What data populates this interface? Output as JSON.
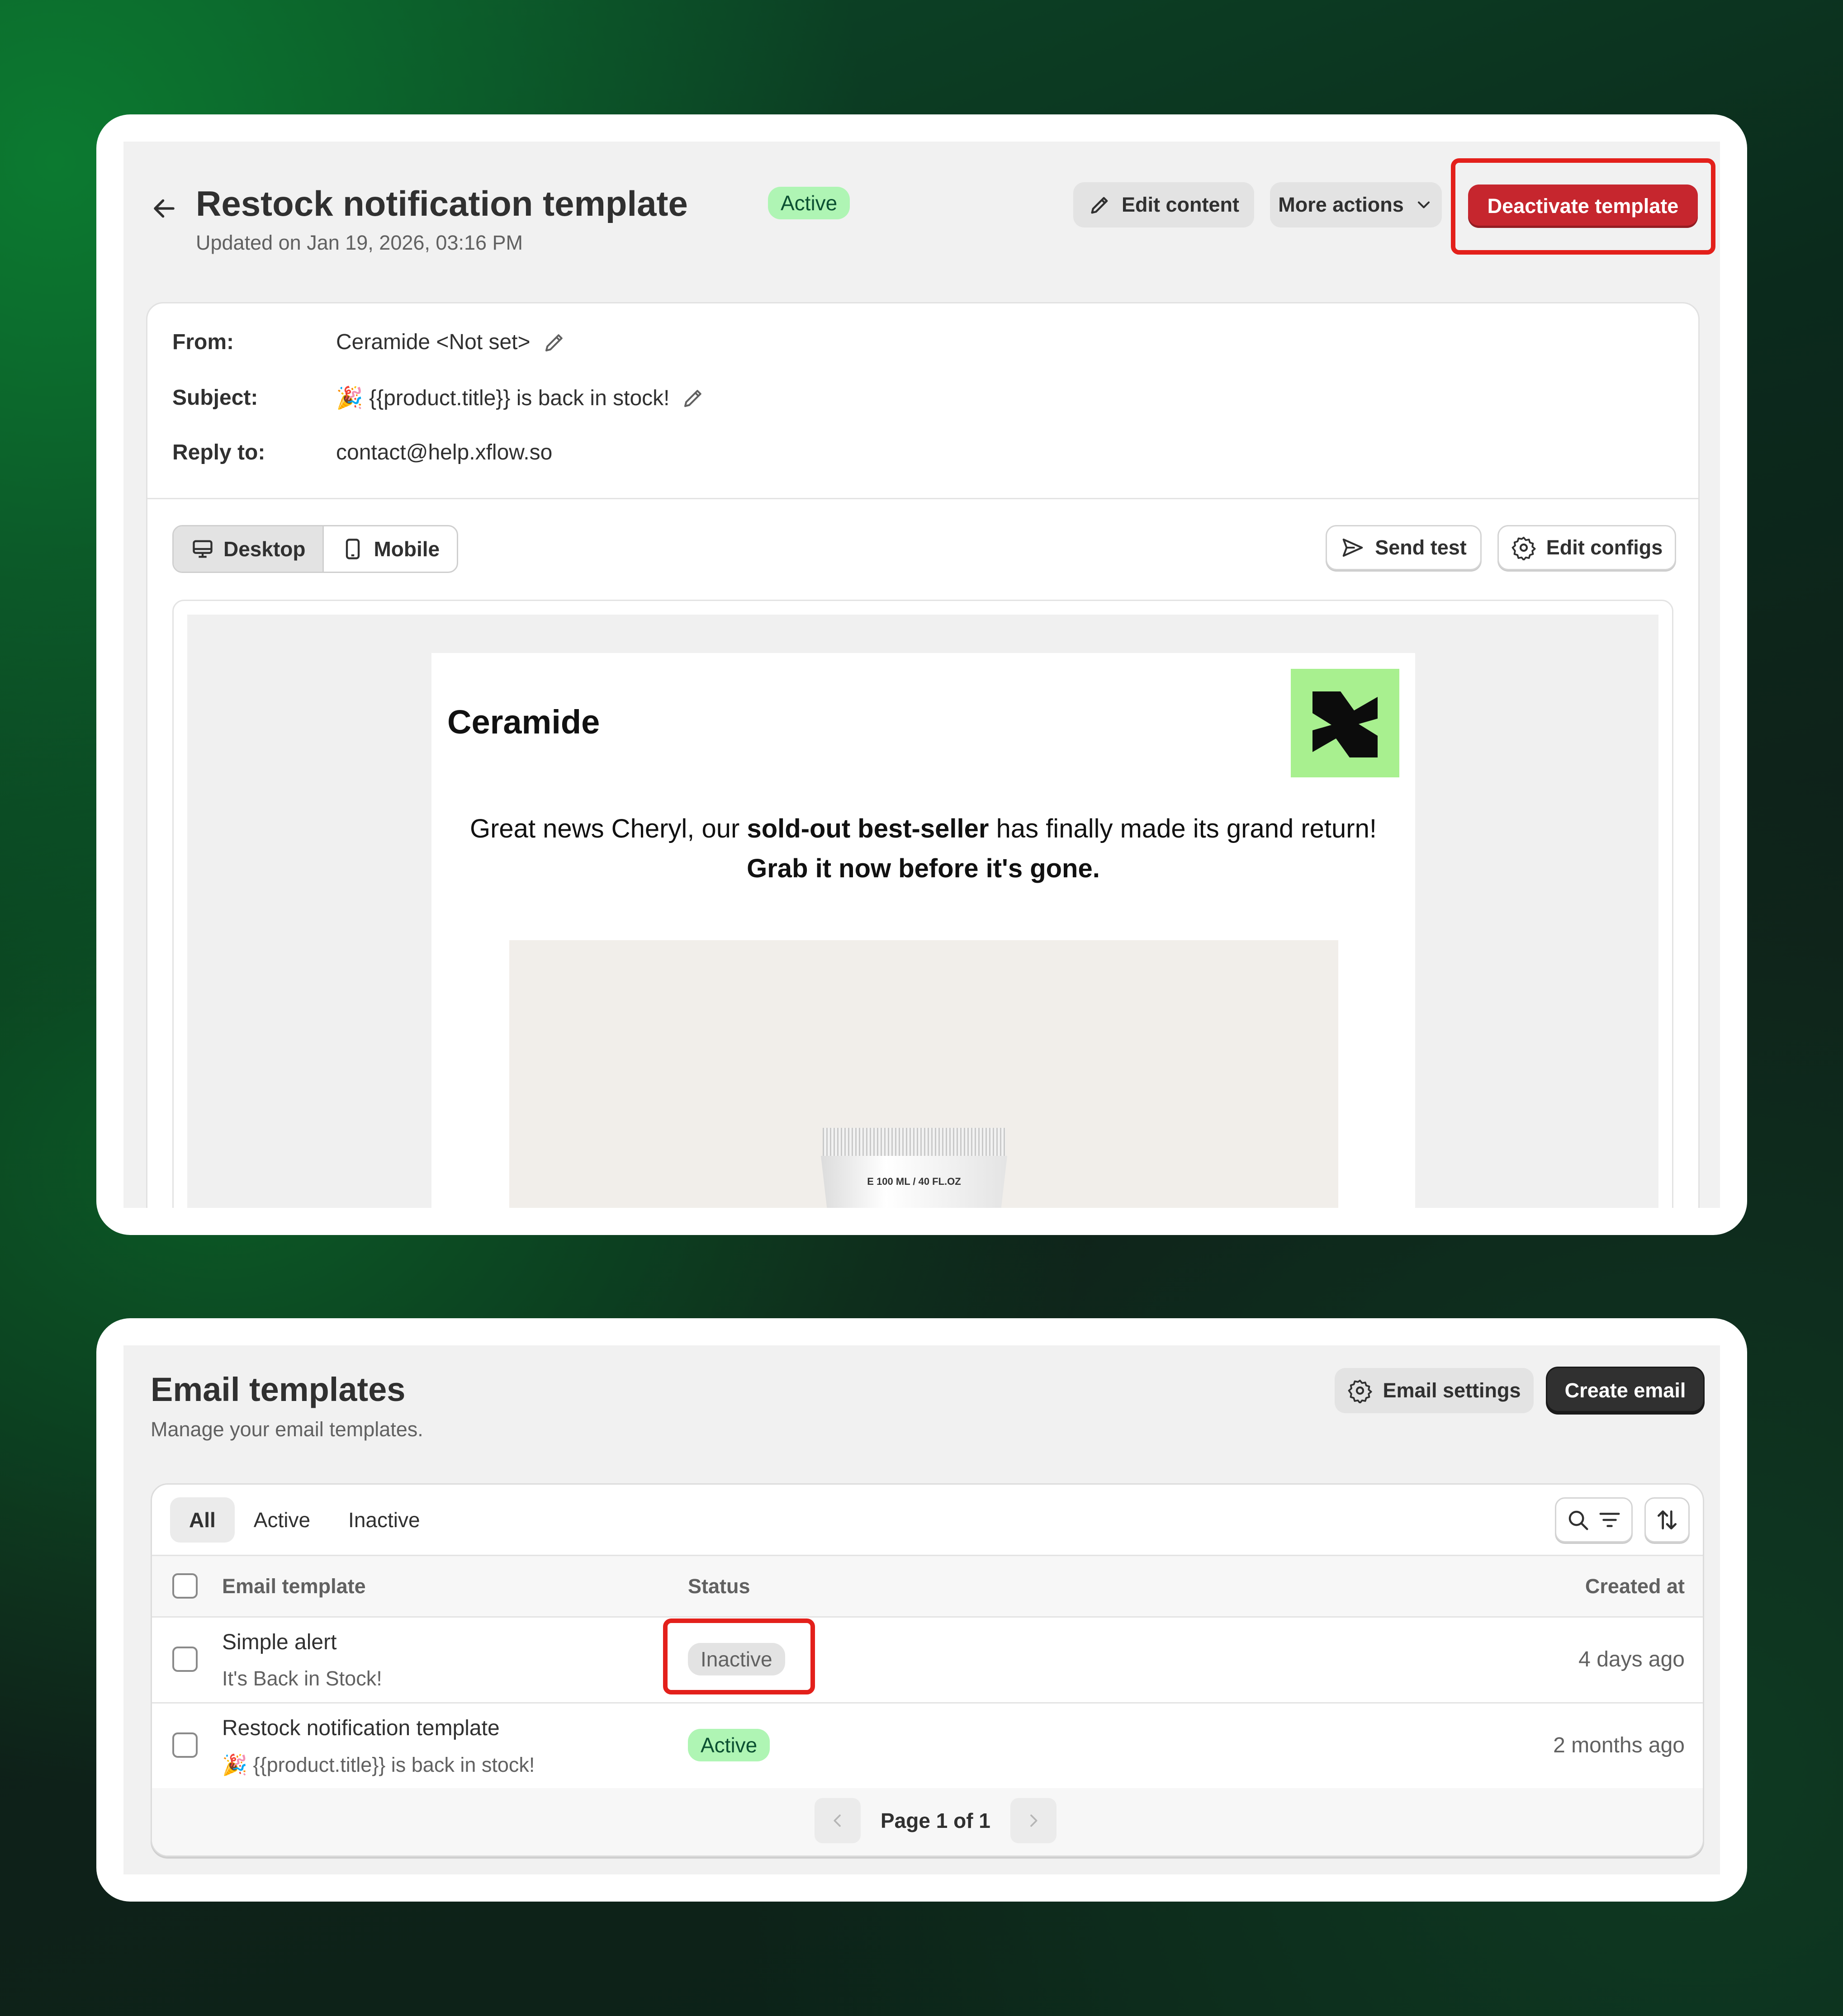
{
  "detail": {
    "title": "Restock notification template",
    "status": "Active",
    "updated": "Updated on Jan 19, 2026, 03:16 PM",
    "actions": {
      "edit_content": "Edit content",
      "more_actions": "More actions",
      "deactivate": "Deactivate template"
    },
    "meta": {
      "from_label": "From:",
      "from_value": "Ceramide <Not set>",
      "subject_label": "Subject:",
      "subject_value": "🎉 {{product.title}} is back in stock!",
      "reply_label": "Reply to:",
      "reply_value": "contact@help.xflow.so"
    },
    "view_toggle": {
      "desktop": "Desktop",
      "mobile": "Mobile",
      "selected": "Desktop"
    },
    "tools": {
      "send_test": "Send test",
      "edit_configs": "Edit configs"
    },
    "preview": {
      "brand": "Ceramide",
      "body_intro": "Great news Cheryl, our ",
      "body_bold": "sold-out best-seller",
      "body_rest": " has finally made its grand return!",
      "body_cta": "Grab it now before it's gone.",
      "product_label": "E 100 ML / 40 FL.OZ",
      "logo_color": "#a8f08f"
    }
  },
  "list": {
    "title": "Email templates",
    "subtitle": "Manage your email templates.",
    "actions": {
      "settings": "Email settings",
      "create": "Create email"
    },
    "tabs": [
      {
        "label": "All",
        "selected": true
      },
      {
        "label": "Active",
        "selected": false
      },
      {
        "label": "Inactive",
        "selected": false
      }
    ],
    "columns": {
      "template": "Email template",
      "status": "Status",
      "created": "Created at"
    },
    "rows": [
      {
        "title": "Simple alert",
        "subtitle": "It's Back in Stock!",
        "status": "Inactive",
        "created": "4 days ago"
      },
      {
        "title": "Restock notification template",
        "subtitle": "🎉 {{product.title}} is back in stock!",
        "status": "Active",
        "created": "2 months ago"
      }
    ],
    "pagination": "Page 1 of 1"
  },
  "colors": {
    "accent_red": "#c6262e",
    "highlight_outline": "#e3201b",
    "active_badge": "#aff5b4",
    "inactive_badge": "#e3e3e3"
  }
}
